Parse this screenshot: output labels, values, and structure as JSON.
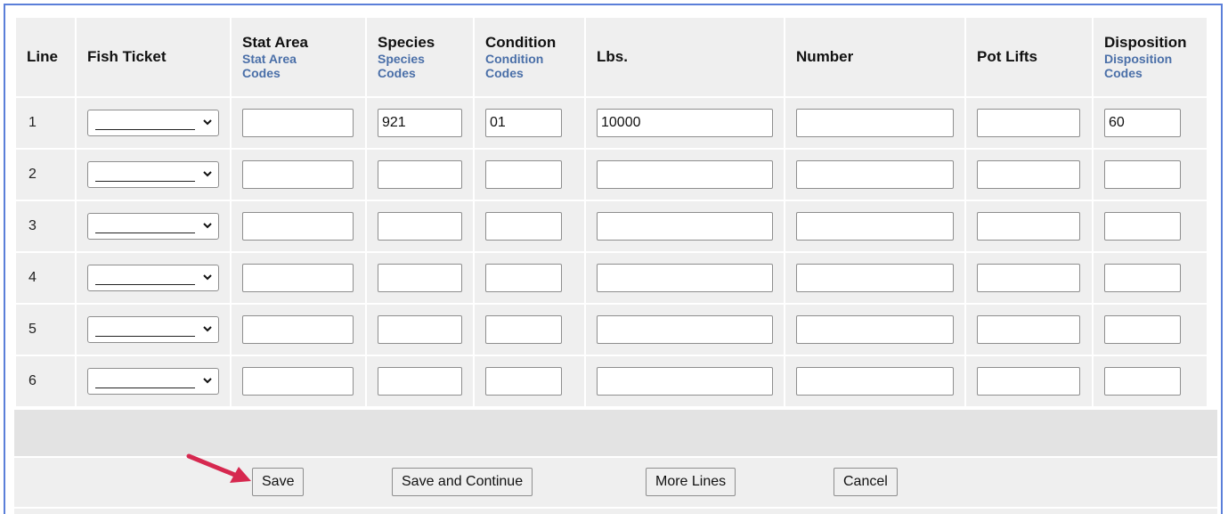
{
  "table": {
    "headers": [
      {
        "title": "Line",
        "link": ""
      },
      {
        "title": "Fish Ticket",
        "link": ""
      },
      {
        "title": "Stat Area",
        "link": "Stat Area Codes"
      },
      {
        "title": "Species",
        "link": "Species Codes"
      },
      {
        "title": "Condition",
        "link": "Condition Codes"
      },
      {
        "title": "Lbs.",
        "link": ""
      },
      {
        "title": "Number",
        "link": ""
      },
      {
        "title": "Pot Lifts",
        "link": ""
      },
      {
        "title": "Disposition",
        "link": "Disposition Codes"
      }
    ],
    "rows": [
      {
        "line": "1",
        "fish_ticket": "",
        "stat_area": "",
        "species": "921",
        "condition": "01",
        "lbs": "10000",
        "number": "",
        "pot_lifts": "",
        "disposition": "60"
      },
      {
        "line": "2",
        "fish_ticket": "",
        "stat_area": "",
        "species": "",
        "condition": "",
        "lbs": "",
        "number": "",
        "pot_lifts": "",
        "disposition": ""
      },
      {
        "line": "3",
        "fish_ticket": "",
        "stat_area": "",
        "species": "",
        "condition": "",
        "lbs": "",
        "number": "",
        "pot_lifts": "",
        "disposition": ""
      },
      {
        "line": "4",
        "fish_ticket": "",
        "stat_area": "",
        "species": "",
        "condition": "",
        "lbs": "",
        "number": "",
        "pot_lifts": "",
        "disposition": ""
      },
      {
        "line": "5",
        "fish_ticket": "",
        "stat_area": "",
        "species": "",
        "condition": "",
        "lbs": "",
        "number": "",
        "pot_lifts": "",
        "disposition": ""
      },
      {
        "line": "6",
        "fish_ticket": "",
        "stat_area": "",
        "species": "",
        "condition": "",
        "lbs": "",
        "number": "",
        "pot_lifts": "",
        "disposition": ""
      }
    ]
  },
  "buttons": {
    "save": "Save",
    "save_continue": "Save and Continue",
    "more_lines": "More Lines",
    "cancel": "Cancel"
  },
  "colors": {
    "frame_border": "#5b7fd9",
    "link": "#4a6fa8",
    "arrow": "#d6284f"
  },
  "annotation": {
    "arrow_icon": "red-arrow-pointing-to-save"
  }
}
